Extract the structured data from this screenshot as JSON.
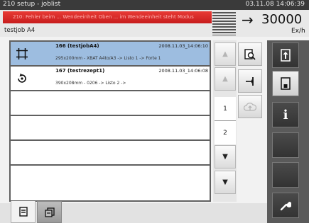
{
  "titlebar": {
    "title": "210 setup - joblist",
    "datetime": "03.11.08 14:06:39"
  },
  "header": {
    "error_text": "210: Fehler beim  ... Wendeeinheit Oben ... im Wendeeinheit steht Modus",
    "subtitle": "testjob A4",
    "speed_value": "30000",
    "speed_unit": "Ex/h",
    "arrow": "→"
  },
  "jobs": [
    {
      "name": "166 (testjobA4)",
      "date": "2008.11.03_14:06:10",
      "details": "295x200mm - XBAT A4to/A3 -> Listo 1 -> Forte 1",
      "icon": "crop-marks-icon",
      "selected": true
    },
    {
      "name": "167 (testrezept1)",
      "date": "2008.11.03_14:06:08",
      "details": "390x208mm - 0206 -> Listo 2 ->",
      "icon": "rotate-icon",
      "selected": false
    },
    {
      "name": "",
      "date": "",
      "details": "",
      "icon": "",
      "selected": false
    },
    {
      "name": "",
      "date": "",
      "details": "",
      "icon": "",
      "selected": false
    },
    {
      "name": "",
      "date": "",
      "details": "",
      "icon": "",
      "selected": false
    },
    {
      "name": "",
      "date": "",
      "details": "",
      "icon": "",
      "selected": false
    }
  ],
  "pager": {
    "page1": "1",
    "page2": "2"
  },
  "icons": {
    "scroll_up": "▲",
    "page_up": "▲",
    "page_down": "▼",
    "scroll_down": "▼",
    "preview": "preview-icon",
    "insert": "insert-icon",
    "upload": "cloud-upload-icon",
    "info": "i",
    "wrench": "wrench-icon"
  },
  "colors": {
    "selected_row": "#9dbde0",
    "error_bar": "#d62a27",
    "sidebar": "#5a5a5a"
  }
}
